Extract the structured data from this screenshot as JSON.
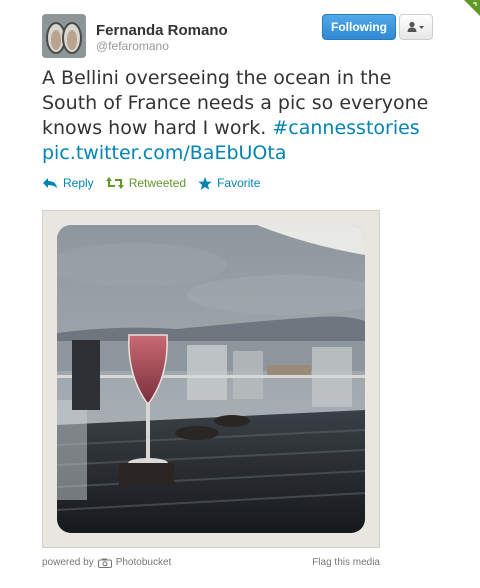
{
  "user": {
    "fullname": "Fernanda Romano",
    "screenname": "@fefaromano"
  },
  "buttons": {
    "follow_label": "Following"
  },
  "tweet": {
    "text_plain": "A Bellini overseeing the ocean in the South of France needs a pic so everyone knows how hard I work.",
    "hashtag": "#cannesstories",
    "media_link": "pic.twitter.com/BaEbUOta"
  },
  "actions": {
    "reply": "Reply",
    "retweeted": "Retweeted",
    "favorite": "Favorite"
  },
  "media": {
    "powered_by": "powered by",
    "provider": "Photobucket",
    "flag_label": "Flag this media"
  },
  "colors": {
    "link": "#0084b4",
    "retweet_green": "#609928",
    "follow_blue": "#2f8ad4"
  }
}
